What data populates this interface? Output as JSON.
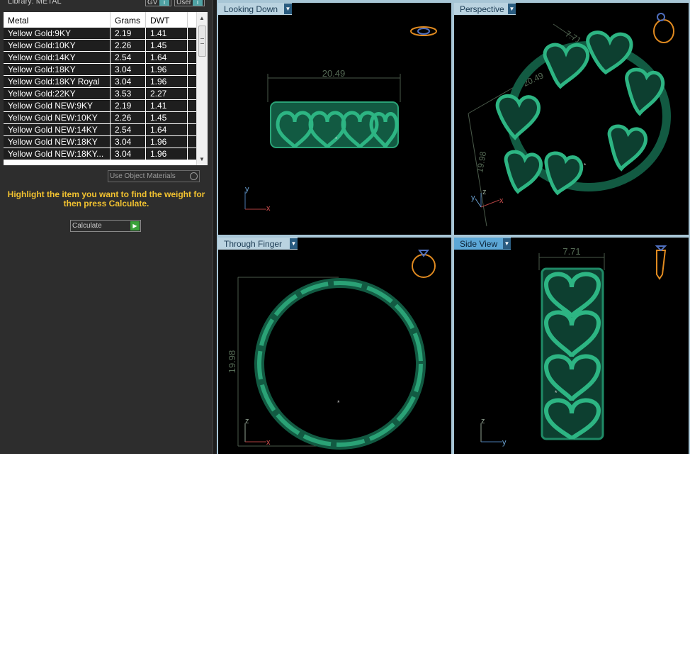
{
  "library_panel": {
    "title": "Library: METAL",
    "gv_label": "GV",
    "user_label": "User",
    "columns": [
      "Metal",
      "Grams",
      "DWT"
    ],
    "rows": [
      [
        "Yellow Gold:9KY",
        "2.19",
        "1.41"
      ],
      [
        "Yellow Gold:10KY",
        "2.26",
        "1.45"
      ],
      [
        "Yellow Gold:14KY",
        "2.54",
        "1.64"
      ],
      [
        "Yellow Gold:18KY",
        "3.04",
        "1.96"
      ],
      [
        "Yellow Gold:18KY Royal",
        "3.04",
        "1.96"
      ],
      [
        "Yellow Gold:22KY",
        "3.53",
        "2.27"
      ],
      [
        "Yellow Gold NEW:9KY",
        "2.19",
        "1.41"
      ],
      [
        "Yellow Gold NEW:10KY",
        "2.26",
        "1.45"
      ],
      [
        "Yellow Gold NEW:14KY",
        "2.54",
        "1.64"
      ],
      [
        "Yellow Gold NEW:18KY",
        "3.04",
        "1.96"
      ],
      [
        "Yellow Gold NEW:18KY...",
        "3.04",
        "1.96"
      ]
    ],
    "use_object_materials_label": "Use Object Materials",
    "hint": "Highlight the item you want to find the weight for then press Calculate.",
    "calculate_label": "Calculate"
  },
  "viewports": {
    "top": {
      "label": "Looking Down",
      "dimension": "20.49",
      "axis_vertical": "y",
      "axis_horizontal": "x"
    },
    "perspective": {
      "label": "Perspective",
      "dimension_width": "20.49",
      "dimension_height": "19.98",
      "dimension_depth": "7.71",
      "axis_z": "z",
      "axis_y": "y",
      "axis_x": "x"
    },
    "front": {
      "label": "Through Finger",
      "dimension": "19.98",
      "axis_vertical": "z",
      "axis_horizontal": "x"
    },
    "side": {
      "label": "Side View",
      "dimension": "7.71",
      "axis_vertical": "z",
      "axis_horizontal": "y"
    }
  },
  "colors": {
    "ring_green": "#1f8a66",
    "panel_bg": "#2d2d2d",
    "hint_yellow": "#f2c230",
    "tab_active": "#5ca7d6",
    "tab_inactive": "#bad3e0"
  },
  "icons": {
    "dropdown": "▼",
    "toggle": "●",
    "go": "▶",
    "scroll_up": "▲",
    "scroll_down": "▼"
  }
}
